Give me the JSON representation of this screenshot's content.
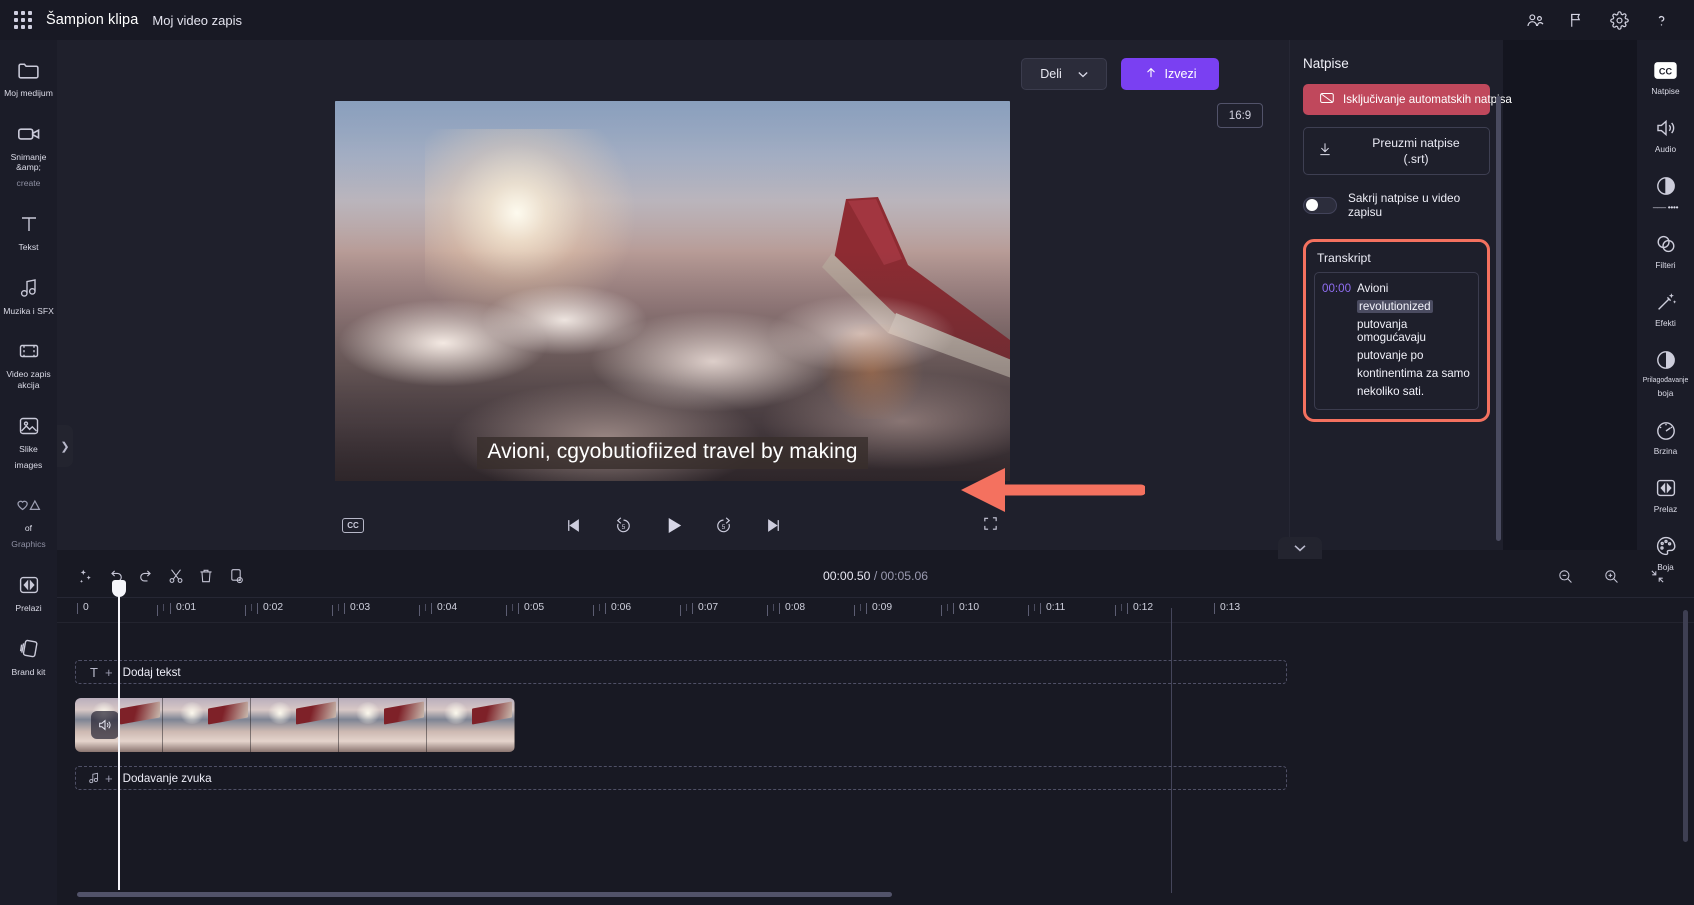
{
  "topbar": {
    "waffle_label": "app-launcher",
    "app_title": "Šampion klipa",
    "project_title": "Moj video zapis",
    "icons": [
      {
        "name": "collaborate-icon",
        "label": "Saradnja"
      },
      {
        "name": "flag-feedback-icon",
        "label": "Povratne informacije"
      },
      {
        "name": "gear-icon",
        "label": "Postavke"
      },
      {
        "name": "help-icon",
        "label": "?"
      }
    ]
  },
  "left_rail": [
    {
      "name": "sidebar-item-my-media",
      "label": "Moj medijum",
      "icon": "folder-icon",
      "dim": false
    },
    {
      "name": "sidebar-item-record-create",
      "label": "Snimanje &amp;",
      "label2": "create",
      "icon": "camera-icon",
      "dim": false
    },
    {
      "name": "sidebar-item-text",
      "label": "Tekst",
      "icon": "text-t-icon",
      "dim": false
    },
    {
      "name": "sidebar-item-music-sfx",
      "label": "Muzika i SFX",
      "icon": "music-note-icon",
      "dim": false
    },
    {
      "name": "sidebar-item-video-actions",
      "label": "Video zapis akcija",
      "icon": "film-strip-icon",
      "dim": false
    },
    {
      "name": "sidebar-item-images",
      "label": "Slike",
      "label2": "images",
      "icon": "image-icon",
      "dim": false
    },
    {
      "name": "sidebar-item-graphics",
      "label": "of",
      "label2": "Graphics",
      "icon": "shapes-icon",
      "dim": true
    },
    {
      "name": "sidebar-item-transitions",
      "label": "Prelazi",
      "icon": "transition-icon",
      "dim": false
    },
    {
      "name": "sidebar-item-brand-kit",
      "label": "Brand kit",
      "icon": "brand-kit-icon",
      "dim": false
    }
  ],
  "stage": {
    "share_label": "Deli",
    "export_label": "Izvezi",
    "aspect_ratio": "16:9",
    "caption_overlay": "Avioni, cgyobutiofiized travel by making",
    "cc_button": "CC"
  },
  "player": {
    "controls": [
      {
        "name": "skip-back-icon",
        "label": "Prethodni"
      },
      {
        "name": "rewind-5-icon",
        "label": "5"
      },
      {
        "name": "play-icon",
        "label": "Reprodukuj"
      },
      {
        "name": "forward-5-icon",
        "label": "5"
      },
      {
        "name": "skip-forward-icon",
        "label": "Sledeći"
      }
    ],
    "fullscreen": "fullscreen-icon"
  },
  "captions_panel": {
    "title": "Natpise",
    "disable_auto_label": "Isključivanje automatskih natpisa",
    "download_srt_line1": "Preuzmi natpise",
    "download_srt_line2": "(.srt)",
    "hide_captions_label": "Sakrij natpise u video zapisu",
    "hide_captions_on": false,
    "transcript_title": "Transkript",
    "highlight_color": "#f4715f",
    "transcript": [
      {
        "time": "00:00",
        "lines": [
          {
            "text": "Avioni",
            "highlighted": false
          },
          {
            "text": "revolutionized",
            "highlighted": true
          },
          {
            "text": "putovanja omogućavaju",
            "highlighted": false
          },
          {
            "text": "putovanje po",
            "highlighted": false
          },
          {
            "text": "kontinentima za samo",
            "highlighted": false
          },
          {
            "text": "nekoliko sati.",
            "highlighted": false
          }
        ]
      }
    ]
  },
  "right_rail": [
    {
      "name": "rail-item-captions",
      "label": "Natpise",
      "icon": "cc-icon"
    },
    {
      "name": "rail-item-audio",
      "label": "Audio",
      "icon": "speaker-icon"
    },
    {
      "name": "rail-item-adjust",
      "label": "",
      "icon": "contrast-half-icon"
    },
    {
      "name": "rail-item-filters",
      "label": "Filteri",
      "icon": "filters-circles-icon"
    },
    {
      "name": "rail-item-effects",
      "label": "Efekti",
      "icon": "magic-wand-icon"
    },
    {
      "name": "rail-item-color-adjust",
      "label": "Prilagođavanje",
      "label2": "boja",
      "icon": "contrast-circle-icon"
    },
    {
      "name": "rail-item-speed",
      "label": "Brzina",
      "icon": "speedometer-icon"
    },
    {
      "name": "rail-item-transition",
      "label": "Prelaz",
      "icon": "transition-icon"
    },
    {
      "name": "rail-item-color",
      "label": "Boja",
      "icon": "palette-icon"
    }
  ],
  "timeline": {
    "tools": [
      {
        "name": "magic-tool-icon",
        "label": "Magija"
      },
      {
        "name": "undo-icon",
        "label": "Opozovi"
      },
      {
        "name": "redo-icon",
        "label": "Ponovi"
      },
      {
        "name": "split-scissors-icon",
        "label": "Podeli"
      },
      {
        "name": "delete-trash-icon",
        "label": "Izbriši"
      },
      {
        "name": "duplicate-icon",
        "label": "Dupliraj"
      }
    ],
    "current_time": "00:00.50",
    "total_time": "/ 00:05.06",
    "zoom_out_icon": "zoom-out-icon",
    "zoom_in_icon": "zoom-in-icon",
    "fit_icon": "fit-timeline-icon",
    "ruler_ticks": [
      "0",
      "0:01",
      "0:02",
      "0:03",
      "0:04",
      "0:05",
      "0:06",
      "0:07",
      "0:08",
      "0:09",
      "0:10",
      "0:11",
      "0:12",
      "0:13"
    ],
    "track_text_label": "Dodaj tekst",
    "track_audio_label": "Dodavanje zvuka",
    "collapse_label": "Skupi"
  }
}
